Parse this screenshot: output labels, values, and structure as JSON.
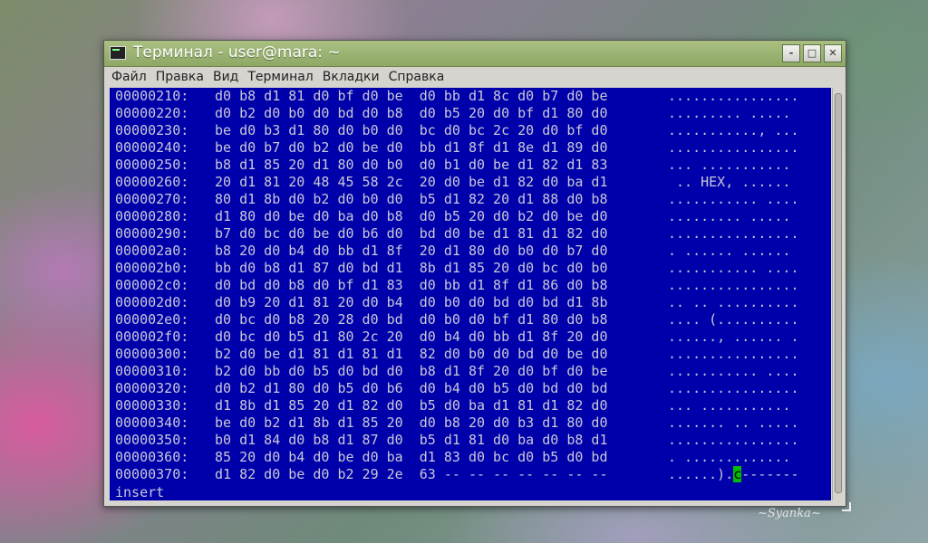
{
  "window": {
    "title": "Терминал - user@mara: ~",
    "buttons": {
      "minimize": "-",
      "maximize": "□",
      "close": "✕"
    }
  },
  "menu": {
    "items": [
      "Файл",
      "Правка",
      "Вид",
      "Терминал",
      "Вкладки",
      "Справка"
    ]
  },
  "terminal": {
    "rows": [
      {
        "offset": "00000210:",
        "hex": "d0 b8 d1 81 d0 bf d0 be  d0 bb d1 8c d0 b7 d0 be",
        "ascii": "................"
      },
      {
        "offset": "00000220:",
        "hex": "d0 b2 d0 b0 d0 bd d0 b8  d0 b5 20 d0 bf d1 80 d0",
        "ascii": "......... ....."
      },
      {
        "offset": "00000230:",
        "hex": "be d0 b3 d1 80 d0 b0 d0  bc d0 bc 2c 20 d0 bf d0",
        "ascii": "..........., ..."
      },
      {
        "offset": "00000240:",
        "hex": "be d0 b7 d0 b2 d0 be d0  bb d1 8f d1 8e d1 89 d0",
        "ascii": "................"
      },
      {
        "offset": "00000250:",
        "hex": "b8 d1 85 20 d1 80 d0 b0  d0 b1 d0 be d1 82 d1 83",
        "ascii": "... ..........."
      },
      {
        "offset": "00000260:",
        "hex": "20 d1 81 20 48 45 58 2c  20 d0 be d1 82 d0 ba d1",
        "ascii": " .. HEX, ......"
      },
      {
        "offset": "00000270:",
        "hex": "80 d1 8b d0 b2 d0 b0 d0  b5 d1 82 20 d1 88 d0 b8",
        "ascii": "........... ...."
      },
      {
        "offset": "00000280:",
        "hex": "d1 80 d0 be d0 ba d0 b8  d0 b5 20 d0 b2 d0 be d0",
        "ascii": "......... ....."
      },
      {
        "offset": "00000290:",
        "hex": "b7 d0 bc d0 be d0 b6 d0  bd d0 be d1 81 d1 82 d0",
        "ascii": "................"
      },
      {
        "offset": "000002a0:",
        "hex": "b8 20 d0 b4 d0 bb d1 8f  20 d1 80 d0 b0 d0 b7 d0",
        "ascii": ". ...... ......"
      },
      {
        "offset": "000002b0:",
        "hex": "bb d0 b8 d1 87 d0 bd d1  8b d1 85 20 d0 bc d0 b0",
        "ascii": "........... ...."
      },
      {
        "offset": "000002c0:",
        "hex": "d0 bd d0 b8 d0 bf d1 83  d0 bb d1 8f d1 86 d0 b8",
        "ascii": "................"
      },
      {
        "offset": "000002d0:",
        "hex": "d0 b9 20 d1 81 20 d0 b4  d0 b0 d0 bd d0 bd d1 8b",
        "ascii": ".. .. .........."
      },
      {
        "offset": "000002e0:",
        "hex": "d0 bc d0 b8 20 28 d0 bd  d0 b0 d0 bf d1 80 d0 b8",
        "ascii": ".... (.........."
      },
      {
        "offset": "000002f0:",
        "hex": "d0 bc d0 b5 d1 80 2c 20  d0 b4 d0 bb d1 8f 20 d0",
        "ascii": "......, ...... ."
      },
      {
        "offset": "00000300:",
        "hex": "b2 d0 be d1 81 d1 81 d1  82 d0 b0 d0 bd d0 be d0",
        "ascii": "................"
      },
      {
        "offset": "00000310:",
        "hex": "b2 d0 bb d0 b5 d0 bd d0  b8 d1 8f 20 d0 bf d0 be",
        "ascii": "........... ...."
      },
      {
        "offset": "00000320:",
        "hex": "d0 b2 d1 80 d0 b5 d0 b6  d0 b4 d0 b5 d0 bd d0 bd",
        "ascii": "................"
      },
      {
        "offset": "00000330:",
        "hex": "d1 8b d1 85 20 d1 82 d0  b5 d0 ba d1 81 d1 82 d0",
        "ascii": "... ..........."
      },
      {
        "offset": "00000340:",
        "hex": "be d0 b2 d1 8b d1 85 20  d0 b8 20 d0 b3 d1 80 d0",
        "ascii": "....... .. ....."
      },
      {
        "offset": "00000350:",
        "hex": "b0 d1 84 d0 b8 d1 87 d0  b5 d1 81 d0 ba d0 b8 d1",
        "ascii": "................"
      },
      {
        "offset": "00000360:",
        "hex": "85 20 d0 b4 d0 be d0 ba  d1 83 d0 bc d0 b5 d0 bd",
        "ascii": ". ............."
      },
      {
        "offset": "00000370:",
        "hex": "d1 82 d0 be d0 b2 29 2e  63 -- -- -- -- -- -- --",
        "ascii": "......).",
        "ascii_cursor": "c",
        "ascii_tail": "-------"
      }
    ],
    "mode": "insert"
  },
  "watermark": "~Syanka~"
}
